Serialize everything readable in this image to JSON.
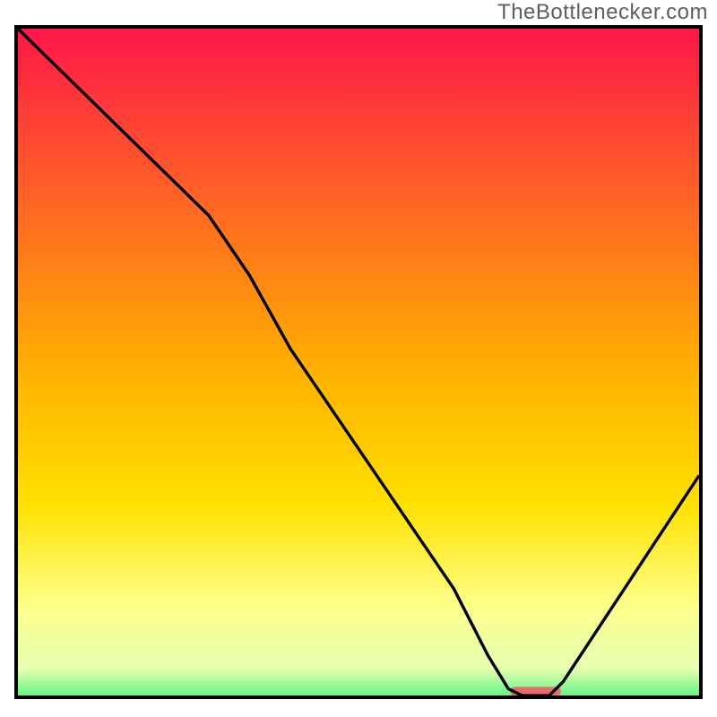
{
  "watermark": "TheBottlenecker.com",
  "chart_data": {
    "type": "line",
    "title": "",
    "xlabel": "",
    "ylabel": "",
    "xlim": [
      0,
      100
    ],
    "ylim": [
      0,
      100
    ],
    "background": {
      "kind": "vertical-gradient",
      "stops": [
        {
          "pct": 0,
          "color": "#ff1749"
        },
        {
          "pct": 50,
          "color": "#ffb000"
        },
        {
          "pct": 70,
          "color": "#ffe100"
        },
        {
          "pct": 85,
          "color": "#fdff8c"
        },
        {
          "pct": 94,
          "color": "#e6ffb0"
        },
        {
          "pct": 100,
          "color": "#1ef071"
        }
      ]
    },
    "series": [
      {
        "name": "curve",
        "x": [
          0,
          6,
          14,
          22,
          28,
          34,
          40,
          48,
          56,
          64,
          69,
          72,
          74,
          78,
          80,
          100
        ],
        "y": [
          100,
          94,
          86,
          78,
          72,
          63,
          52,
          40,
          28,
          16,
          6,
          1,
          0,
          0,
          2,
          33
        ]
      }
    ],
    "segment_marker": {
      "x_start": 73,
      "x_end": 79,
      "y": 0.6,
      "color": "#ea6a6f",
      "thickness_pct": 1.4
    }
  }
}
